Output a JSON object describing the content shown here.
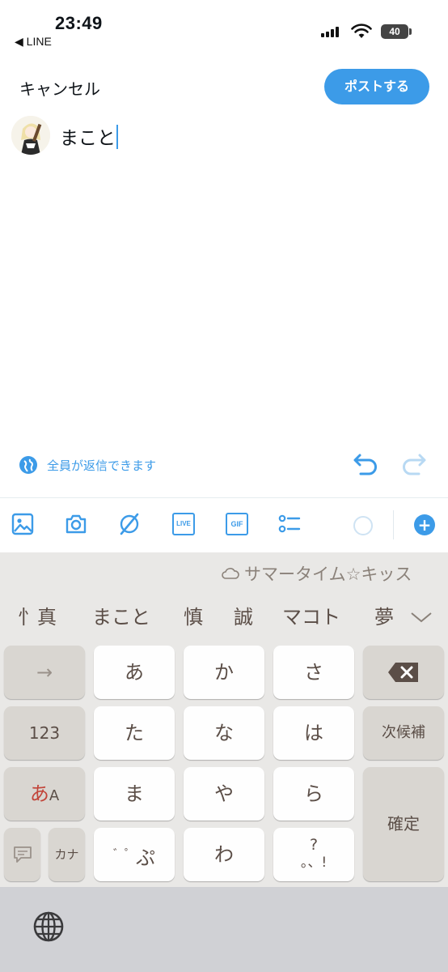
{
  "status_bar": {
    "time": "23:49",
    "back_app": "◀ LINE",
    "battery_level": "40"
  },
  "compose": {
    "cancel_label": "キャンセル",
    "post_label": "ポストする",
    "text": "まこと",
    "reply_setting": "全員が返信できます"
  },
  "toolbar": {
    "icons": [
      "image-icon",
      "camera-icon",
      "grok-icon",
      "live-icon",
      "gif-icon",
      "poll-icon"
    ],
    "live_label": "LIVE",
    "gif_label": "GIF",
    "accent": "#3c9be8"
  },
  "keyboard": {
    "suggestion": "サマータイム☆キッス",
    "candidates": [
      "忄真",
      "まこと",
      "慎",
      "誠",
      "マコト",
      "夢"
    ],
    "keys": {
      "arrow": "→",
      "a": "あ",
      "ka": "か",
      "sa": "さ",
      "num": "123",
      "ta": "た",
      "na": "な",
      "ha": "は",
      "next_candidate": "次候補",
      "mode": "あ",
      "mode_sub": "A",
      "ma": "ま",
      "ya": "や",
      "ra": "ら",
      "confirm": "確定",
      "kana": "カナ",
      "dakuten": "゛゜",
      "dakuten_char": "ぷ",
      "wa": "わ",
      "punct_top": "?",
      "punct_bottom": "。、!"
    }
  }
}
